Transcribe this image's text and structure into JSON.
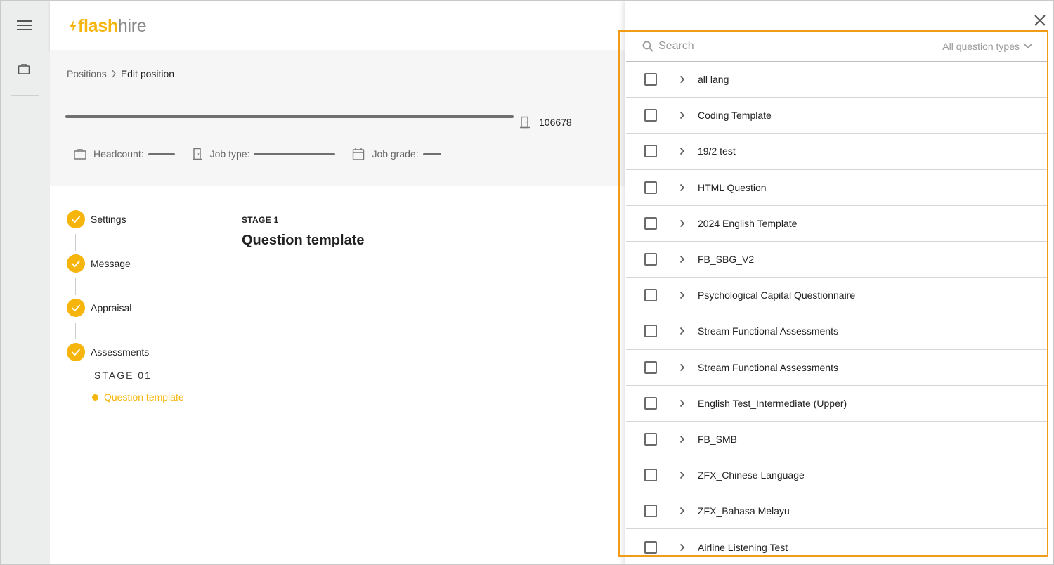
{
  "brand": {
    "flash": "flash",
    "hire": "hire",
    "accent": "#f5b50c"
  },
  "nav": {
    "menu_icon": "hamburger-icon",
    "positions_icon": "briefcase-icon"
  },
  "breadcrumb": {
    "parent": "Positions",
    "current": "Edit position"
  },
  "position": {
    "id": "106678",
    "headcount_label": "Headcount:",
    "job_type_label": "Job type:",
    "job_grade_label": "Job grade:"
  },
  "steps": [
    {
      "label": "Settings"
    },
    {
      "label": "Message"
    },
    {
      "label": "Appraisal"
    },
    {
      "label": "Assessments"
    }
  ],
  "stage_group_label": "STAGE 01",
  "active_sub_item": "Question template",
  "main": {
    "stage_small": "STAGE 1",
    "title": "Question template"
  },
  "drawer": {
    "search_placeholder": "Search",
    "type_filter": "All question types",
    "highlight_color": "#f29b14",
    "templates": [
      "all lang",
      "Coding Template",
      "19/2 test",
      "HTML Question",
      "2024 English Template",
      "FB_SBG_V2",
      "Psychological Capital Questionnaire",
      "Stream Functional Assessments",
      "Stream Functional Assessments",
      "English Test_Intermediate (Upper)",
      "FB_SMB",
      "ZFX_Chinese Language",
      "ZFX_Bahasa Melayu",
      "Airline Listening Test"
    ]
  }
}
